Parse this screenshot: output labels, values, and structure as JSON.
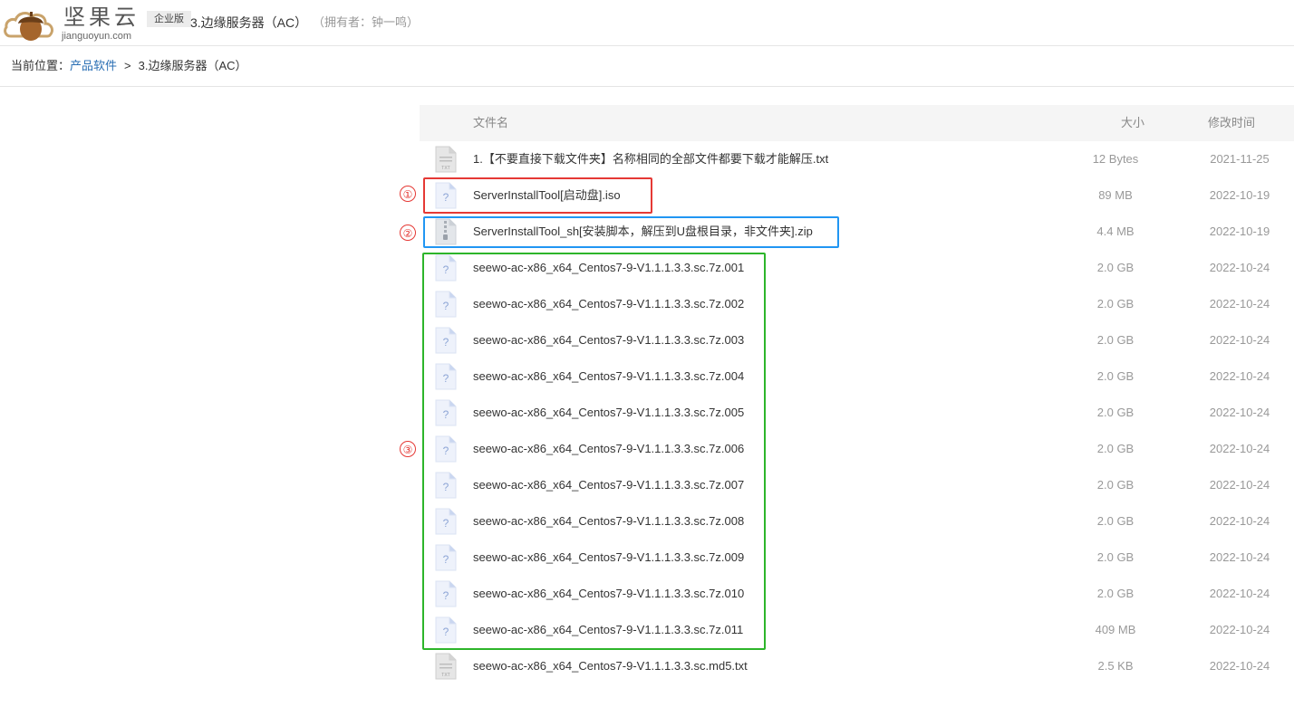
{
  "header": {
    "logo_cn": "坚果云",
    "logo_en": "jianguoyun.com",
    "edition": "企业版",
    "folder_title": "3.边缘服务器（AC）",
    "owner": "（拥有者：钟一鸣）"
  },
  "breadcrumb": {
    "prefix": "当前位置：",
    "root": "产品软件",
    "separator": ">",
    "current": "3.边缘服务器（AC）"
  },
  "table": {
    "columns": {
      "name": "文件名",
      "size": "大小",
      "modified": "修改时间"
    },
    "rows": [
      {
        "name": "1.【不要直接下载文件夹】名称相同的全部文件都要下载才能解压.txt",
        "size": "12 Bytes",
        "modified": "2021-11-25",
        "icon": "txt-file-icon"
      },
      {
        "name": "ServerInstallTool[启动盘].iso",
        "size": "89 MB",
        "modified": "2022-10-19",
        "icon": "unknown-file-icon"
      },
      {
        "name": "ServerInstallTool_sh[安装脚本，解压到U盘根目录，非文件夹].zip",
        "size": "4.4 MB",
        "modified": "2022-10-19",
        "icon": "zip-file-icon"
      },
      {
        "name": "seewo-ac-x86_x64_Centos7-9-V1.1.1.3.3.sc.7z.001",
        "size": "2.0 GB",
        "modified": "2022-10-24",
        "icon": "unknown-file-icon"
      },
      {
        "name": "seewo-ac-x86_x64_Centos7-9-V1.1.1.3.3.sc.7z.002",
        "size": "2.0 GB",
        "modified": "2022-10-24",
        "icon": "unknown-file-icon"
      },
      {
        "name": "seewo-ac-x86_x64_Centos7-9-V1.1.1.3.3.sc.7z.003",
        "size": "2.0 GB",
        "modified": "2022-10-24",
        "icon": "unknown-file-icon"
      },
      {
        "name": "seewo-ac-x86_x64_Centos7-9-V1.1.1.3.3.sc.7z.004",
        "size": "2.0 GB",
        "modified": "2022-10-24",
        "icon": "unknown-file-icon"
      },
      {
        "name": "seewo-ac-x86_x64_Centos7-9-V1.1.1.3.3.sc.7z.005",
        "size": "2.0 GB",
        "modified": "2022-10-24",
        "icon": "unknown-file-icon"
      },
      {
        "name": "seewo-ac-x86_x64_Centos7-9-V1.1.1.3.3.sc.7z.006",
        "size": "2.0 GB",
        "modified": "2022-10-24",
        "icon": "unknown-file-icon"
      },
      {
        "name": "seewo-ac-x86_x64_Centos7-9-V1.1.1.3.3.sc.7z.007",
        "size": "2.0 GB",
        "modified": "2022-10-24",
        "icon": "unknown-file-icon"
      },
      {
        "name": "seewo-ac-x86_x64_Centos7-9-V1.1.1.3.3.sc.7z.008",
        "size": "2.0 GB",
        "modified": "2022-10-24",
        "icon": "unknown-file-icon"
      },
      {
        "name": "seewo-ac-x86_x64_Centos7-9-V1.1.1.3.3.sc.7z.009",
        "size": "2.0 GB",
        "modified": "2022-10-24",
        "icon": "unknown-file-icon"
      },
      {
        "name": "seewo-ac-x86_x64_Centos7-9-V1.1.1.3.3.sc.7z.010",
        "size": "2.0 GB",
        "modified": "2022-10-24",
        "icon": "unknown-file-icon"
      },
      {
        "name": "seewo-ac-x86_x64_Centos7-9-V1.1.1.3.3.sc.7z.011",
        "size": "409 MB",
        "modified": "2022-10-24",
        "icon": "unknown-file-icon"
      },
      {
        "name": "seewo-ac-x86_x64_Centos7-9-V1.1.1.3.3.sc.md5.txt",
        "size": "2.5 KB",
        "modified": "2022-10-24",
        "icon": "txt-file-icon"
      }
    ]
  },
  "annotations": {
    "mark1": "①",
    "mark2": "②",
    "mark3": "③",
    "colors": {
      "mark1": "#e53935",
      "mark2": "#2196f3",
      "mark3": "#2db52a"
    }
  }
}
